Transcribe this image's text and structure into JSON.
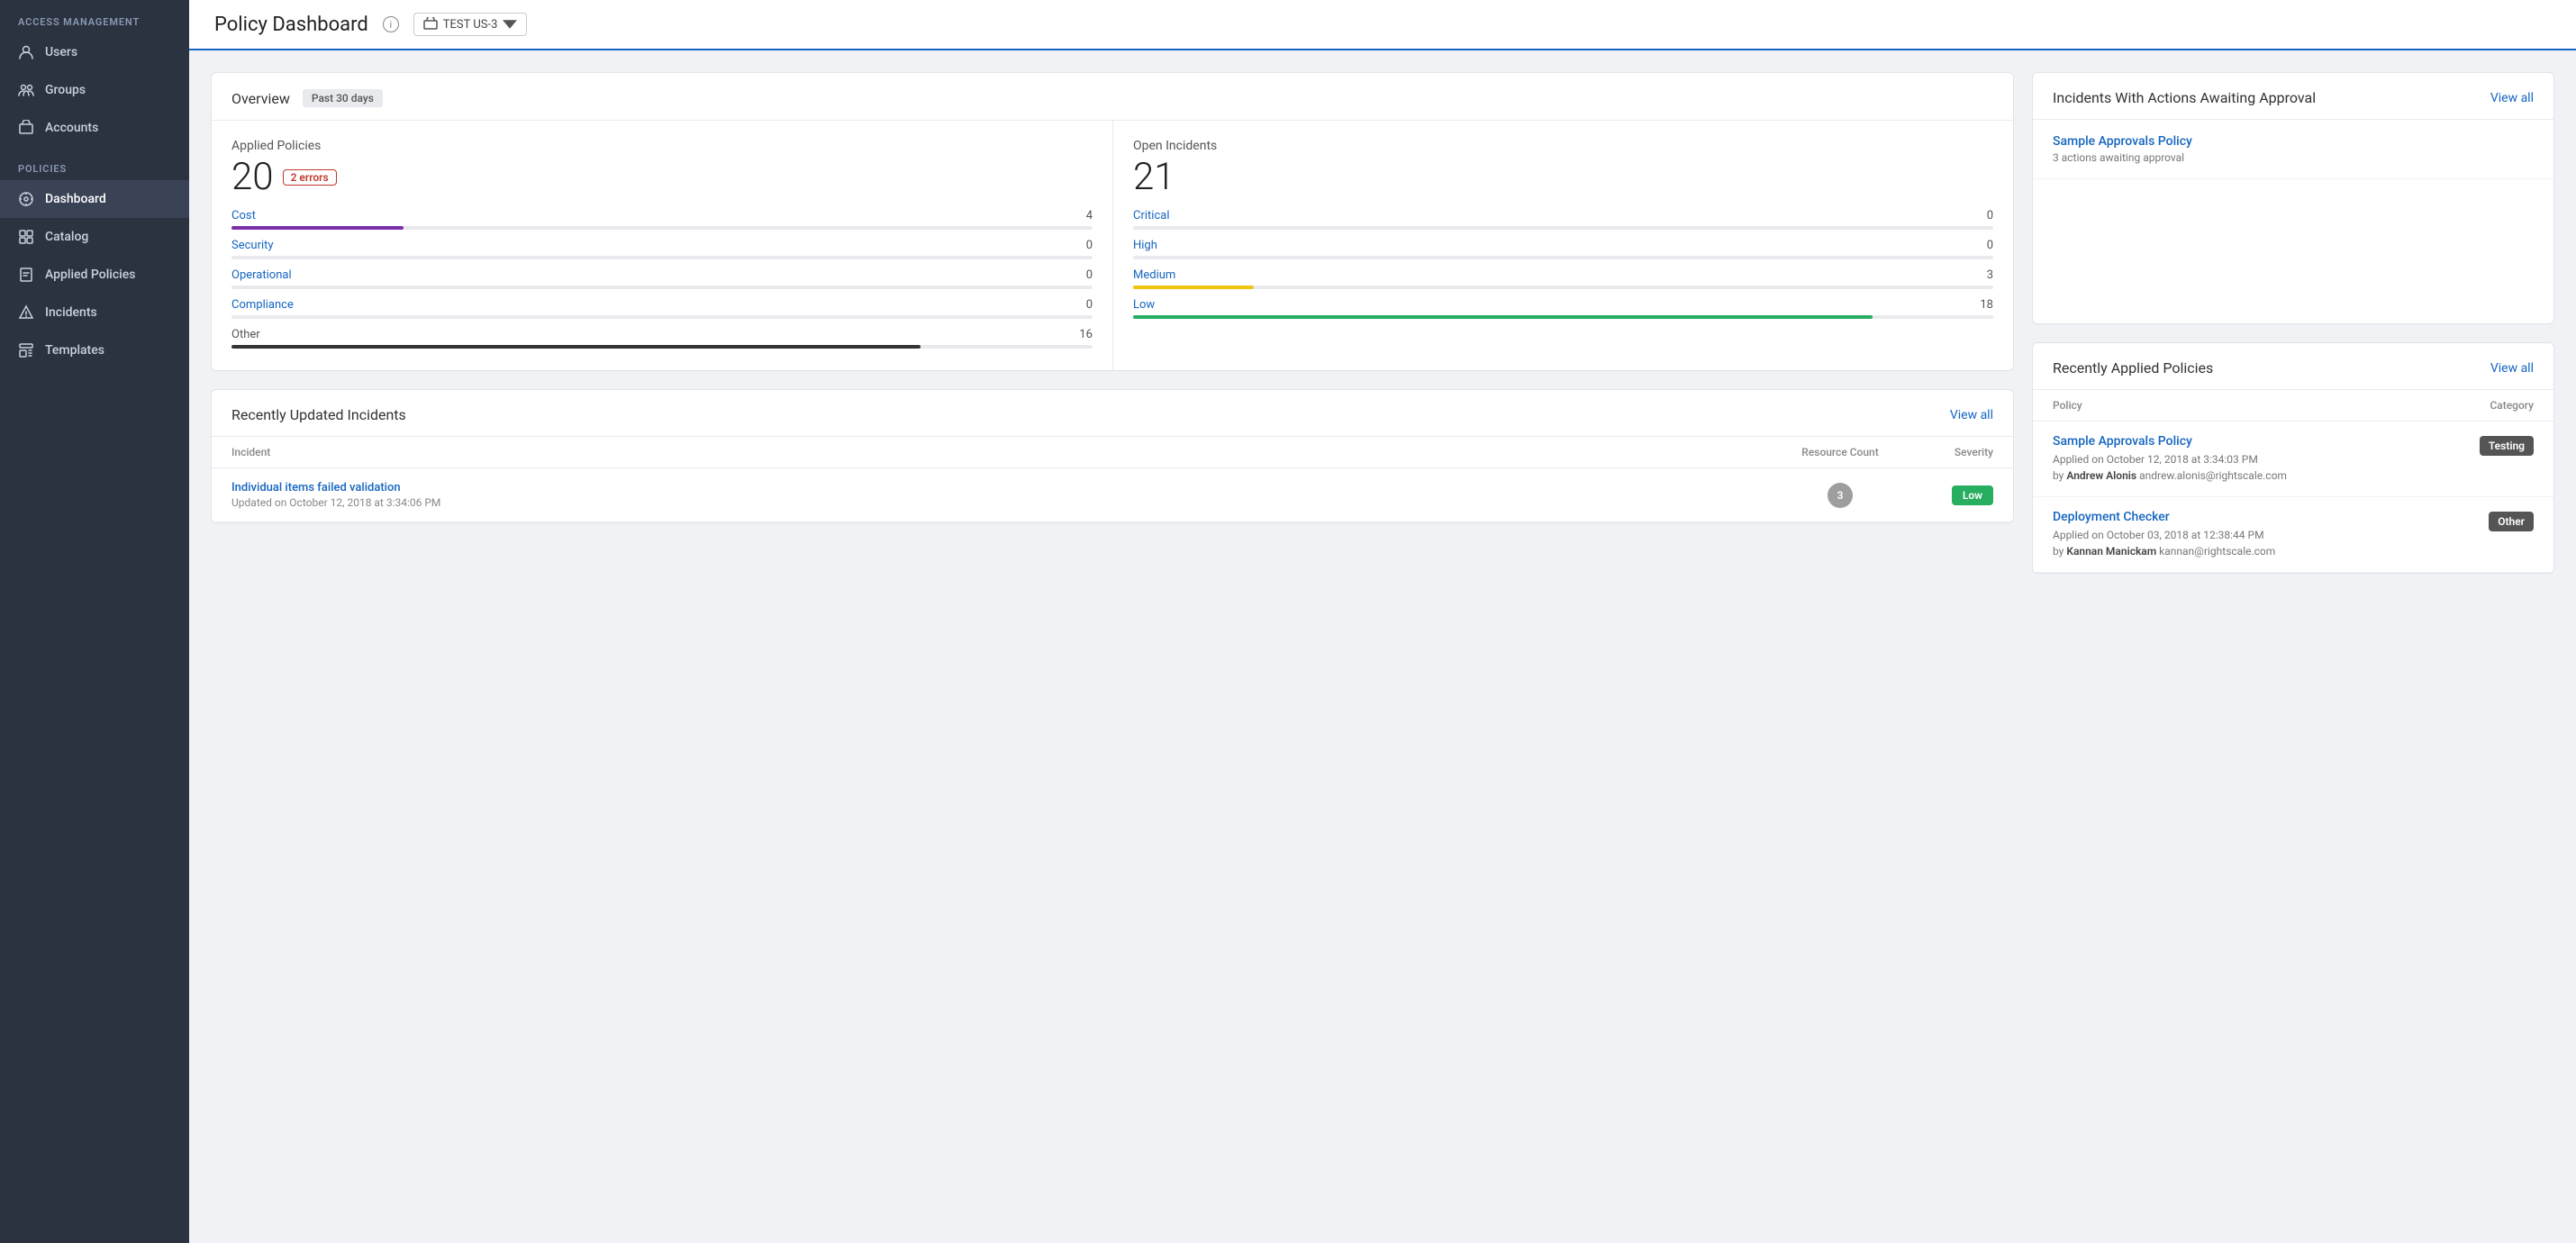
{
  "app": {
    "section_label": "Access Management",
    "nav_items": [
      {
        "id": "users",
        "label": "Users",
        "icon": "user"
      },
      {
        "id": "groups",
        "label": "Groups",
        "icon": "users"
      },
      {
        "id": "accounts",
        "label": "Accounts",
        "icon": "briefcase"
      }
    ],
    "policies_label": "Policies",
    "policy_nav_items": [
      {
        "id": "dashboard",
        "label": "Dashboard",
        "icon": "dashboard",
        "active": true
      },
      {
        "id": "catalog",
        "label": "Catalog",
        "icon": "catalog"
      },
      {
        "id": "applied",
        "label": "Applied Policies",
        "icon": "applied"
      },
      {
        "id": "incidents",
        "label": "Incidents",
        "icon": "incidents"
      },
      {
        "id": "templates",
        "label": "Templates",
        "icon": "templates"
      }
    ]
  },
  "topbar": {
    "title": "Policy Dashboard",
    "account_name": "TEST US-3"
  },
  "overview": {
    "title": "Overview",
    "period": "Past 30 days",
    "applied_policies": {
      "label": "Applied Policies",
      "count": "20",
      "error_badge": "2 errors",
      "categories": [
        {
          "name": "Cost",
          "value": 4,
          "max": 20,
          "color": "#7b2fa8"
        },
        {
          "name": "Security",
          "value": 0,
          "max": 20,
          "color": "#1565c0"
        },
        {
          "name": "Operational",
          "value": 0,
          "max": 20,
          "color": "#1565c0"
        },
        {
          "name": "Compliance",
          "value": 0,
          "max": 20,
          "color": "#1565c0"
        },
        {
          "name": "Other",
          "value": 16,
          "max": 20,
          "color": "#333"
        }
      ]
    },
    "open_incidents": {
      "label": "Open Incidents",
      "count": "21",
      "severities": [
        {
          "name": "Critical",
          "value": 0,
          "max": 21,
          "color": "#c0392b"
        },
        {
          "name": "High",
          "value": 0,
          "max": 21,
          "color": "#e67e22"
        },
        {
          "name": "Medium",
          "value": 3,
          "max": 21,
          "color": "#f1c40f"
        },
        {
          "name": "Low",
          "value": 18,
          "max": 21,
          "color": "#27ae60"
        }
      ]
    }
  },
  "recently_updated_incidents": {
    "title": "Recently Updated Incidents",
    "view_all": "View all",
    "columns": [
      "Incident",
      "Resource Count",
      "Severity"
    ],
    "rows": [
      {
        "name": "Individual items failed validation",
        "updated": "Updated on October 12, 2018 at 3:34:06 PM",
        "resource_count": "3",
        "severity": "Low",
        "severity_class": "severity-low"
      }
    ]
  },
  "incidents_with_approval": {
    "title": "Incidents With Actions Awaiting Approval",
    "view_all": "View all",
    "items": [
      {
        "name": "Sample Approvals Policy",
        "subtitle": "3 actions awaiting approval"
      }
    ]
  },
  "recently_applied_policies": {
    "title": "Recently Applied Policies",
    "view_all": "View all",
    "columns": [
      "Policy",
      "Category"
    ],
    "rows": [
      {
        "name": "Sample Approvals Policy",
        "applied_on": "Applied on October 12, 2018 at 3:34:03 PM",
        "by_label": "by",
        "by_name": "Andrew Alonis",
        "by_email": "andrew.alonis@rightscale.com",
        "category": "Testing",
        "category_class": "cat-testing"
      },
      {
        "name": "Deployment Checker",
        "applied_on": "Applied on October 03, 2018 at 12:38:44 PM",
        "by_label": "by",
        "by_name": "Kannan Manickam",
        "by_email": "kannan@rightscale.com",
        "category": "Other",
        "category_class": "cat-other"
      }
    ]
  }
}
